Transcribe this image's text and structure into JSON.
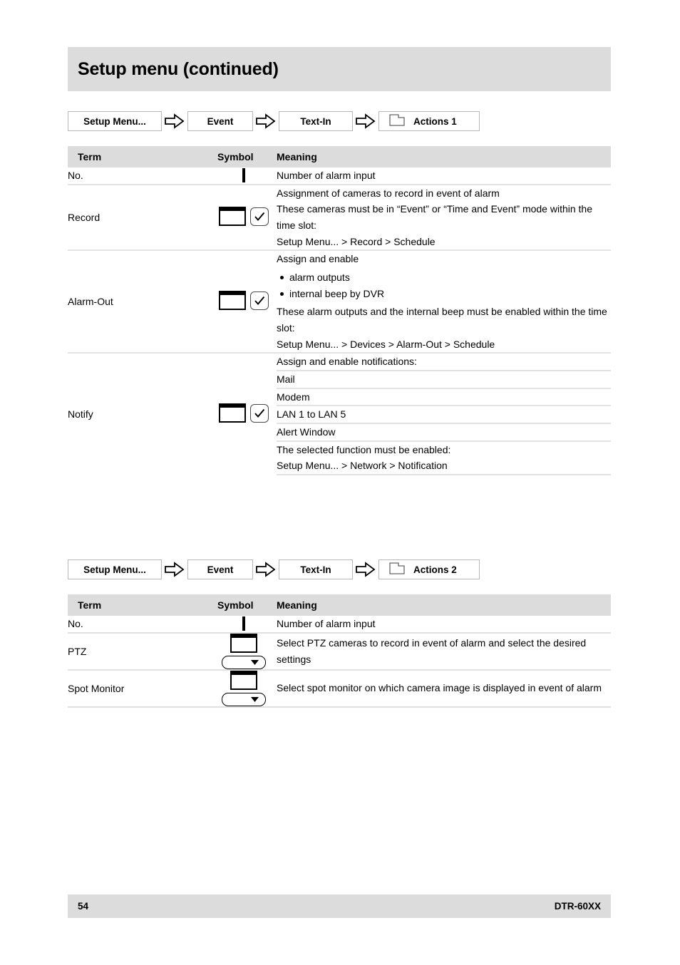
{
  "page": {
    "title": "Setup menu (continued)",
    "footer": {
      "page_number": "54",
      "document_code": "DTR-60XX"
    },
    "colors": {
      "band_grey": "#dcdcdc",
      "rule_grey": "#e2e2e2",
      "text": "#000000"
    }
  },
  "breadcrumb_1": {
    "items": [
      {
        "label": "Setup Menu...",
        "icon": ""
      },
      {
        "label": "Event",
        "icon": ""
      },
      {
        "label": "Text-In",
        "icon": ""
      },
      {
        "label": "Actions 1",
        "icon": "folder-icon"
      }
    ],
    "separator_icon": "arrow-right-icon"
  },
  "breadcrumb_2": {
    "items": [
      {
        "label": "Setup Menu...",
        "icon": ""
      },
      {
        "label": "Event",
        "icon": ""
      },
      {
        "label": "Text-In",
        "icon": ""
      },
      {
        "label": "Actions 2",
        "icon": "folder-icon"
      }
    ],
    "separator_icon": "arrow-right-icon"
  },
  "table_1": {
    "headers": {
      "term": "Term",
      "symbol": "Symbol",
      "meaning": "Meaning"
    },
    "rows": [
      {
        "term": "No.",
        "symbol_icon": "text-field-box-icon",
        "meaning_lines": [
          "Number of alarm input"
        ]
      },
      {
        "term": "Record",
        "symbol_icon": "window-box-and-checkmark-icon",
        "meaning_lines": [
          "Assignment of cameras to record in event of alarm",
          "These cameras must be in “Event” or “Time and Event” mode within the time slot:",
          "Setup Menu... > Record > Schedule"
        ]
      },
      {
        "term": "Alarm-Out",
        "symbol_icon": "window-box-and-checkmark-icon",
        "meaning_intro": "Assign and enable",
        "bullets": [
          "alarm outputs",
          "internal beep by DVR"
        ],
        "meaning_lines": [
          "These alarm outputs and the internal beep must be enabled within the time slot:",
          "Setup Menu... > Devices > Alarm-Out > Schedule"
        ]
      },
      {
        "term": "Notify",
        "symbol_icon": "window-box-and-checkmark-icon",
        "sub_rows": [
          {
            "text": "Assign and enable notifications:"
          },
          {
            "text": "Mail"
          },
          {
            "text": "Modem"
          },
          {
            "text": "LAN 1 to LAN 5"
          },
          {
            "text": "Alert Window"
          },
          {
            "text_lines": [
              "The selected function must be enabled:",
              "Setup Menu... > Network > Notification"
            ]
          }
        ]
      }
    ]
  },
  "table_2": {
    "headers": {
      "term": "Term",
      "symbol": "Symbol",
      "meaning": "Meaning"
    },
    "rows": [
      {
        "term": "No.",
        "symbol_icon": "text-field-box-icon",
        "meaning_lines": [
          "Number of alarm input"
        ]
      },
      {
        "term": "PTZ",
        "symbol_icon": "window-box-and-dropdown-icon",
        "meaning_lines": [
          "Select PTZ cameras to record in event of alarm and select the desired settings"
        ]
      },
      {
        "term": "Spot Monitor",
        "symbol_icon": "window-box-and-dropdown-icon",
        "meaning_lines": [
          "Select spot monitor on which camera image is displayed in event of alarm"
        ]
      }
    ]
  }
}
